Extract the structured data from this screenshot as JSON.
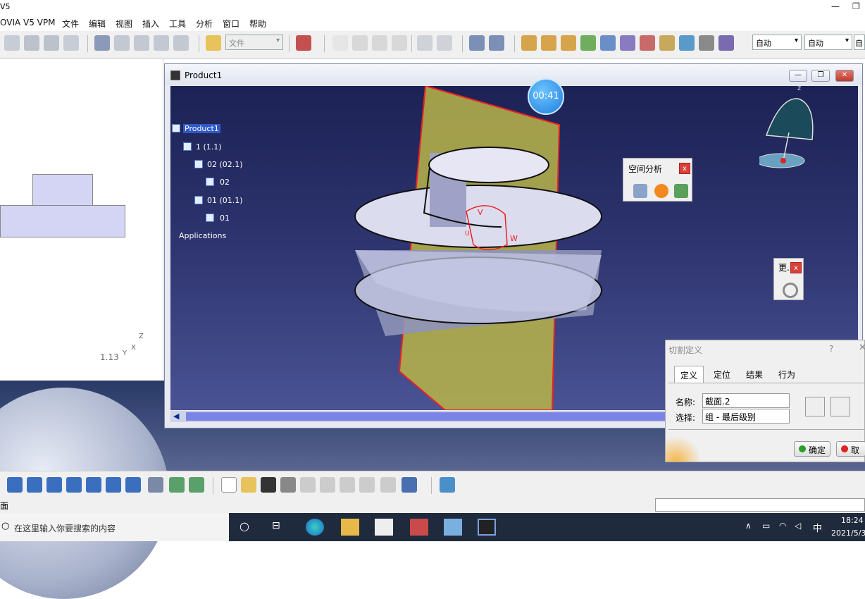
{
  "app_title": "V5",
  "menus": [
    "OVIA V5 VPM",
    "文件",
    "编辑",
    "视图",
    "插入",
    "工具",
    "分析",
    "窗口",
    "帮助"
  ],
  "toolbar": {
    "file_combo": "文件",
    "combo1": "自动",
    "combo2": "自动",
    "combo3": "自"
  },
  "viewport_window": {
    "title": "Product1"
  },
  "timer": "00:41",
  "tree": {
    "root": "Product1",
    "items": [
      "1 (1.1)",
      "02 (02.1)",
      "02",
      "01 (01.1)",
      "01",
      "Applications"
    ]
  },
  "left_axis_label": "1.13",
  "axis_labels": {
    "z": "Z",
    "x": "X",
    "y": "Y"
  },
  "triad_labels": {
    "v": "V",
    "w": "W",
    "u": "U"
  },
  "compass_label": "z",
  "spatial_panel": {
    "title": "空间分析",
    "close": "x"
  },
  "more_panel": {
    "title": "更.",
    "close": "x"
  },
  "cut_dialog": {
    "title": "切割定义",
    "help": "?",
    "tabs": [
      "定义",
      "定位",
      "结果",
      "行为"
    ],
    "name_label": "名称:",
    "name_value": "截面.2",
    "select_label": "选择:",
    "select_value": "组 - 最后级别",
    "ok": "确定",
    "cancel": "取消"
  },
  "status_text": "面",
  "taskbar": {
    "search_placeholder": "在这里输入你要搜索的内容",
    "time": "18:24",
    "date": "2021/5/3",
    "ime": "中"
  }
}
